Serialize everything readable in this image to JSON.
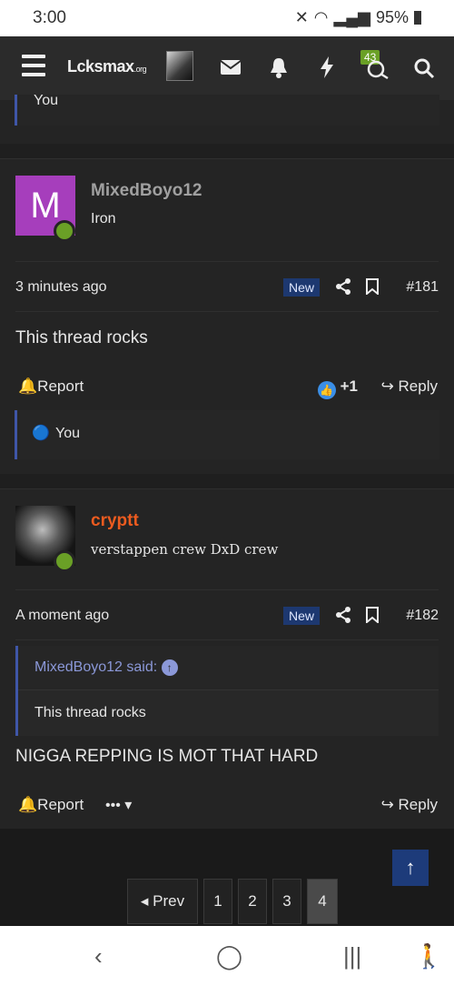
{
  "status": {
    "time": "3:00",
    "battery": "95%"
  },
  "nav": {
    "logo": "Lcksmax",
    "logo_suffix": ".org",
    "badge_count": "43"
  },
  "prev_post": {
    "reaction_user": "You"
  },
  "post181": {
    "avatar_letter": "M",
    "username": "MixedBoyo12",
    "user_title": "Iron",
    "date": "3 minutes ago",
    "new_label": "New",
    "number": "#181",
    "body": "This thread rocks",
    "report_label": "Report",
    "like_count": "+1",
    "reply_label": "Reply",
    "reaction_user": "You"
  },
  "post182": {
    "username": "cryptt",
    "user_title": "verstappen crew DxD crew",
    "date": "A moment ago",
    "new_label": "New",
    "number": "#182",
    "quote_author": "MixedBoyo12 said:",
    "quote_text": "This thread rocks",
    "body": "NIGGA REPPING IS MOT THAT HARD",
    "report_label": "Report",
    "more_label": "•••",
    "reply_label": "Reply"
  },
  "pager": {
    "prev_label": "Prev",
    "pages": [
      "1",
      "2",
      "3",
      "4"
    ],
    "current": "4"
  }
}
